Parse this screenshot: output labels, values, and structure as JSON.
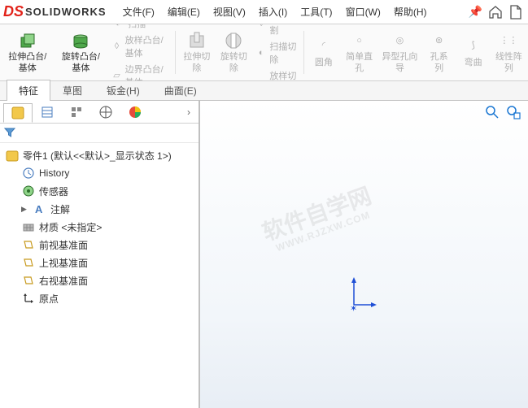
{
  "app": {
    "name": "SOLIDWORKS"
  },
  "menu": {
    "file": "文件(F)",
    "edit": "编辑(E)",
    "view": "视图(V)",
    "insert": "插入(I)",
    "tools": "工具(T)",
    "window": "窗口(W)",
    "help": "帮助(H)"
  },
  "ribbon": {
    "extrude": "拉伸凸台/基体",
    "revolve": "旋转凸台/基体",
    "sweep": "扫描",
    "loft": "放样凸台/基体",
    "boundary": "边界凸台/基体",
    "cut_extrude": "拉伸切除",
    "cut_revolve": "旋转切除",
    "cut_loft": "放样切割",
    "cut_sweep": "扫描切除",
    "cut_boundary": "放样切割",
    "fillet": "圆角",
    "chamfer": "简单直孔",
    "shell": "异型孔向导",
    "hole": "孔系列",
    "wrap": "弯曲",
    "lpattern": "线性阵列"
  },
  "tabs": {
    "feature": "特征",
    "sketch": "草图",
    "sheetmetal": "钣金(H)",
    "surface": "曲面(E)"
  },
  "tree": {
    "root": "零件1 (默认<<默认>_显示状态 1>)",
    "history": "History",
    "sensors": "传感器",
    "annotations": "注解",
    "material": "材质 <未指定>",
    "front": "前视基准面",
    "top": "上视基准面",
    "right": "右视基准面",
    "origin": "原点"
  },
  "watermark": {
    "main": "软件自学网",
    "sub": "WWW.RJZXW.COM"
  },
  "chart_data": null
}
